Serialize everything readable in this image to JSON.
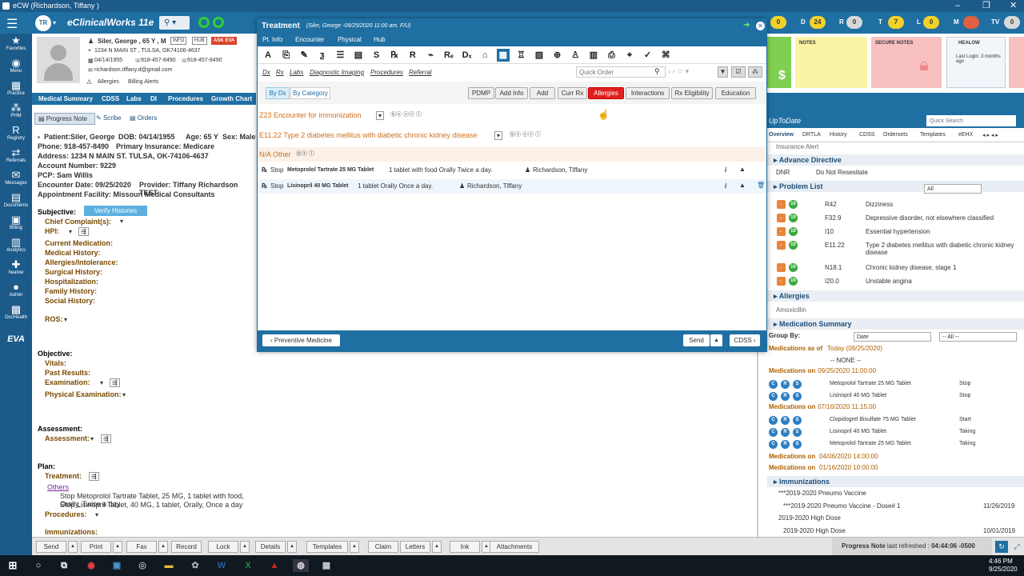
{
  "window": {
    "title": "eCW (Richardson, Tiffany )"
  },
  "topbar": {
    "initials": "TR",
    "app_name": "eClinicalWorks 11e",
    "counters": [
      {
        "letter": "D",
        "value": "24",
        "color": "#f2d12a"
      },
      {
        "letter": "R",
        "value": "0",
        "color": "#d8d8d8"
      },
      {
        "letter": "T",
        "value": "7",
        "color": "#f2d12a"
      },
      {
        "letter": "L",
        "value": "0",
        "color": "#f2d12a"
      },
      {
        "letter": "M",
        "value": "",
        "color": "#e06040"
      },
      {
        "letter": "TV",
        "value": "0",
        "color": "#d8d8d8"
      }
    ],
    "first_counter": "0"
  },
  "leftnav": [
    "Favorites",
    "Menu",
    "Practice",
    "PHM",
    "Registry",
    "Referrals",
    "Messages",
    "Documents",
    "Billing",
    "Analytics",
    "healow",
    "Admin",
    "OccHealth",
    "EVA"
  ],
  "patient_header": {
    "name": "Siler, George , 65 Y , M",
    "info_btn": "INFO",
    "hub_btn": "HUB",
    "ask_eva": "ASK EVA",
    "address": "1234 N MAIN ST , TULSA, OK74106-4637",
    "dob": "04/14/1955",
    "phone1": "918-457-8490",
    "phone2": "918-457-8490",
    "email": "richardson.tiffany.d@gmail.com",
    "allergies": "Allergies",
    "billing_alerts": "Billing Alerts"
  },
  "patient_tabs": [
    "Medical Summary",
    "CDSS",
    "Labs",
    "DI",
    "Procedures",
    "Growth Chart"
  ],
  "note_tabs": {
    "progress": "Progress Note",
    "scribe": "Scribe",
    "orders": "Orders"
  },
  "patient_info": {
    "patient": "Patient:Siler, George",
    "dob": "DOB: 04/14/1955",
    "age": "Age: 65 Y",
    "sex": "Sex: Male",
    "phone": "Phone: 918-457-8490",
    "insurance": "Primary Insurance: Medicare",
    "address": "Address: 1234 N MAIN ST. TULSA, OK-74106-4637",
    "account": "Account Number: 9229",
    "pcp": "PCP: Sam Willis",
    "encounter": "Encounter Date: 09/25/2020",
    "provider": "Provider: Tiffany Richardson TEST",
    "facility": "Appointment Facility: Missouri Medical Consultants"
  },
  "subjective": {
    "title": "Subjective:",
    "verify": "Verify Histories",
    "items": [
      "Chief Complaint(s):",
      "HPI:",
      "Current Medication:",
      "Medical History:",
      "Allergies/Intolerance:",
      "Surgical History:",
      "Hospitalization:",
      "Family History:",
      "Social History:"
    ],
    "ros": "ROS:"
  },
  "objective": {
    "title": "Objective:",
    "vitals": "Vitals:",
    "past": "Past Results:",
    "exam": "Examination:",
    "physical": "Physical Examination:"
  },
  "assessment": {
    "title": "Assessment:",
    "item": "Assessment:"
  },
  "plan": {
    "title": "Plan:",
    "treatment": "Treatment:",
    "others": "Others",
    "line1": "Stop Metoprolol Tartrate Tablet, 25 MG, 1 tablet with food, Orally, Twice a day",
    "line2": "Stop Lisinopril Tablet, 40 MG, 1 tablet, Orally, Once a day",
    "procedures": "Procedures:",
    "immunizations": "Immunizations:"
  },
  "modal": {
    "title": "Treatment",
    "subtitle": "(Siler, George -09/25/2020 11:00 am, F/U)",
    "menu": [
      "Pt. Info",
      "Encounter",
      "Physical",
      "Hub"
    ],
    "tools": [
      "A",
      "⎘",
      "✎",
      "ƺ",
      "☰",
      "▤",
      "S",
      "℞",
      "R",
      "⌁",
      "Rₑ",
      "Dₓ",
      "⌂",
      "▦",
      "♖",
      "▧",
      "⊕",
      "♙",
      "▥",
      "⎙",
      "⌖",
      "✓",
      "⌘"
    ],
    "links": [
      "Dx",
      "Rx",
      "Labs",
      "Diagnostic Imaging",
      "Procedures",
      "Referral"
    ],
    "quick_order": "Quick Order",
    "view_dx": "By Dx",
    "view_cat": "By Category",
    "buttons": [
      "PDMP",
      "Add Info",
      "Add",
      "Curr Rx",
      "Allergies",
      "Interactions",
      "Rx Eligibility",
      "Education"
    ],
    "dx1": "Z23 Encounter for immunization",
    "dx2": "E11.22 Type 2 diabetes mellitus with diabetic chronic kidney disease",
    "na_other": "N/A Other",
    "rx1_pre": "Stop",
    "rx1_drug": "Metoprolol Tartrate 25 MG Tablet",
    "rx1_sig": "1 tablet with food Orally Twice a day.",
    "rx1_prov": "Richardson, Tiffany",
    "rx2_pre": "Stop",
    "rx2_drug": "Lisinopril 40 MG Tablet",
    "rx2_sig": "1 tablet Orally Once a day.",
    "rx2_prov": "Richardson, Tiffany",
    "prev_btn": "Preventive Medicine",
    "send_btn": "Send",
    "cdss_btn": "CDSS"
  },
  "notes_panel": {
    "notes": "NOTES",
    "secure": "SECURE NOTES",
    "healow": "HEALOW",
    "last_login": "Last Login: 3 months ago"
  },
  "right_panel": {
    "title": "UpToDate",
    "quick_search": "Quick Search",
    "tabs": [
      "Overview",
      "DRTLA",
      "History",
      "CDSS",
      "Ordersets",
      "Templates",
      "eEHX"
    ],
    "insurance_alert": "Insurance Alert",
    "advance_directive": "Advance Directive",
    "dnr": "DNR",
    "dnr_desc": "Do Not Resesitate",
    "problem_list": "Problem List",
    "pl_filter": "All",
    "problems": [
      {
        "code": "R42",
        "desc": "Dizziness"
      },
      {
        "code": "F32.9",
        "desc": "Depressive disorder, not elsewhere classified"
      },
      {
        "code": "I10",
        "desc": "Essential hypertension"
      },
      {
        "code": "E11.22",
        "desc": "Type 2 diabetes mellitus with diabetic chronic kidney disease"
      },
      {
        "code": "N18.1",
        "desc": "Chronic kidney disease, stage 1"
      },
      {
        "code": "I20.0",
        "desc": "Unstable angina"
      }
    ],
    "allergies": "Allergies",
    "amoxicillin": "Amoxicillin",
    "med_summary": "Medication Summary",
    "group_by": "Group By:",
    "group_val": "Date",
    "all_val": "-- All --",
    "med_asof": "Medications as of",
    "today": "Today (09/25/2020)",
    "none": "-- NONE --",
    "med_groups": [
      {
        "label": "Medications on",
        "date": "09/25/2020 11:00:00",
        "items": [
          [
            "Metoprolol Tartrate 25 MG Tablet",
            "Stop"
          ],
          [
            "Lisinopril 40 MG Tablet",
            "Stop"
          ]
        ]
      },
      {
        "label": "Medications on",
        "date": "07/16/2020 11:15:00",
        "items": [
          [
            "Clopidogrel Bisulfate 75 MG Tablet",
            "Start"
          ],
          [
            "Lisinopril 40 MG Tablet",
            "Taking"
          ],
          [
            "Metoprolol Tartrate 25 MG Tablet",
            "Taking"
          ]
        ]
      }
    ],
    "med_on3": "Medications on",
    "med_on3_date": "04/06/2020 14:00:00",
    "med_on4": "Medications on",
    "med_on4_date": "01/16/2020 10:00:00",
    "immunizations": "Immunizations",
    "imm_items": [
      {
        "name": "***2019-2020 Pneumo Vaccine",
        "sub": "***2019-2020 Pneumo Vaccine - Dose# 1",
        "date": "11/26/2019"
      },
      {
        "name": "2019-2020 High Dose",
        "sub": "2019-2020 High Dose",
        "date": "10/01/2019"
      }
    ]
  },
  "bottombar": {
    "buttons": [
      "Send",
      "Print",
      "Fax",
      "Record",
      "Lock",
      "Details",
      "Templates",
      "Claim",
      "Letters",
      "Ink",
      "Attachments"
    ],
    "status_bold": "Progress Note",
    "status_text": "last refreshed :",
    "status_time": "04:44:06 -0500"
  },
  "taskbar": {
    "time": "4:46 PM",
    "date": "9/25/2020"
  }
}
